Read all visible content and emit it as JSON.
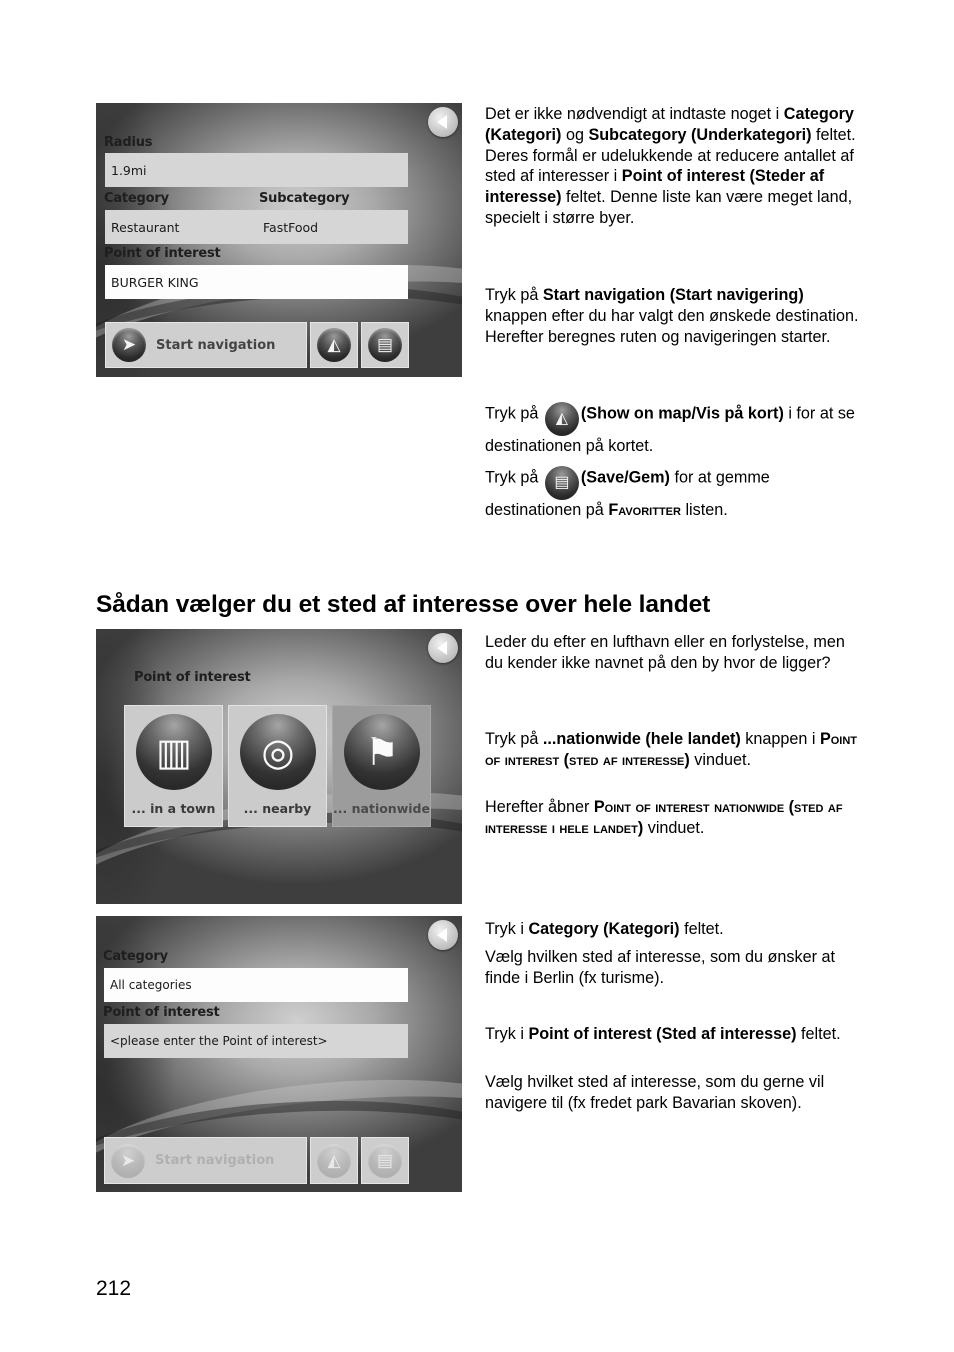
{
  "screen1": {
    "radius_label": "Radius",
    "radius_value": "1.9mi",
    "category_label": "Category",
    "subcategory_label": "Subcategory",
    "category_value": "Restaurant",
    "subcategory_value": "FastFood",
    "poi_label": "Point of interest",
    "poi_value": "BURGER KING",
    "start_nav_label": "Start navigation",
    "icons": {
      "back": "back-arrow-icon",
      "start": "navigation-arrow-icon",
      "map": "map-icon",
      "save": "floppy-disk-icon"
    }
  },
  "text1": {
    "p1_a": "Det er ikke nødvendigt at indtaste noget i ",
    "p1_b": "Category (Kategori)",
    "p1_c": " og ",
    "p1_d": "Subcategory (Underkategori)",
    "p1_e": " feltet. Deres formål er udelukkende at reducere antallet af sted af interesser i ",
    "p1_f": "Point of interest (Steder af interesse)",
    "p1_g": " feltet. Denne liste kan være meget land, specielt i større byer.",
    "p2_a": "Tryk på ",
    "p2_b": "Start navigation (Start navigering)",
    "p2_c": " knappen efter du har valgt den ønskede destination. Herefter beregnes ruten og navigeringen starter.",
    "p3_a": "Tryk på ",
    "p3_b": "(Show on map/Vis på kort)",
    "p3_c": " i for at se destinationen på kortet.",
    "p4_a": "Tryk på ",
    "p4_b": "(Save/Gem)",
    "p4_c": " for at gemme destinationen på ",
    "p4_d": "Favoritter",
    "p4_e": " listen."
  },
  "heading": "Sådan vælger du et sted af interesse over hele landet",
  "screen2": {
    "title": "Point of interest",
    "tiles": [
      {
        "label": "... in a town",
        "icon": "city-buildings-icon",
        "selected": false
      },
      {
        "label": "... nearby",
        "icon": "target-icon",
        "selected": false
      },
      {
        "label": "... nationwide",
        "icon": "flags-icon",
        "selected": true
      }
    ]
  },
  "text2": {
    "p1": "Leder du efter en lufthavn eller en forlystelse, men du kender ikke navnet på den by hvor de ligger?",
    "p2_a": "Tryk på ",
    "p2_b": "...nationwide (hele landet)",
    "p2_c": " knappen i ",
    "p2_d": "Point of interest (sted af interesse)",
    "p2_e": " vinduet.",
    "p3_a": "Herefter åbner ",
    "p3_b": "Point of interest nationwide (sted af interesse i hele landet)",
    "p3_c": " vinduet."
  },
  "screen3": {
    "category_label": "Category",
    "category_value": "All categories",
    "poi_label": "Point of interest",
    "poi_placeholder": "<please enter the Point of interest>",
    "start_nav_label": "Start navigation"
  },
  "text3": {
    "p1_a": "Tryk i ",
    "p1_b": "Category (Kategori)",
    "p1_c": " feltet.",
    "p2": "Vælg hvilken sted af interesse, som du ønsker at finde i Berlin (fx turisme).",
    "p3_a": "Tryk i ",
    "p3_b": "Point of interest (Sted af interesse)",
    "p3_c": " feltet.",
    "p4": "Vælg hvilket sted af interesse, som du gerne vil navigere til (fx fredet park Bavarian skoven)."
  },
  "page_number": "212"
}
